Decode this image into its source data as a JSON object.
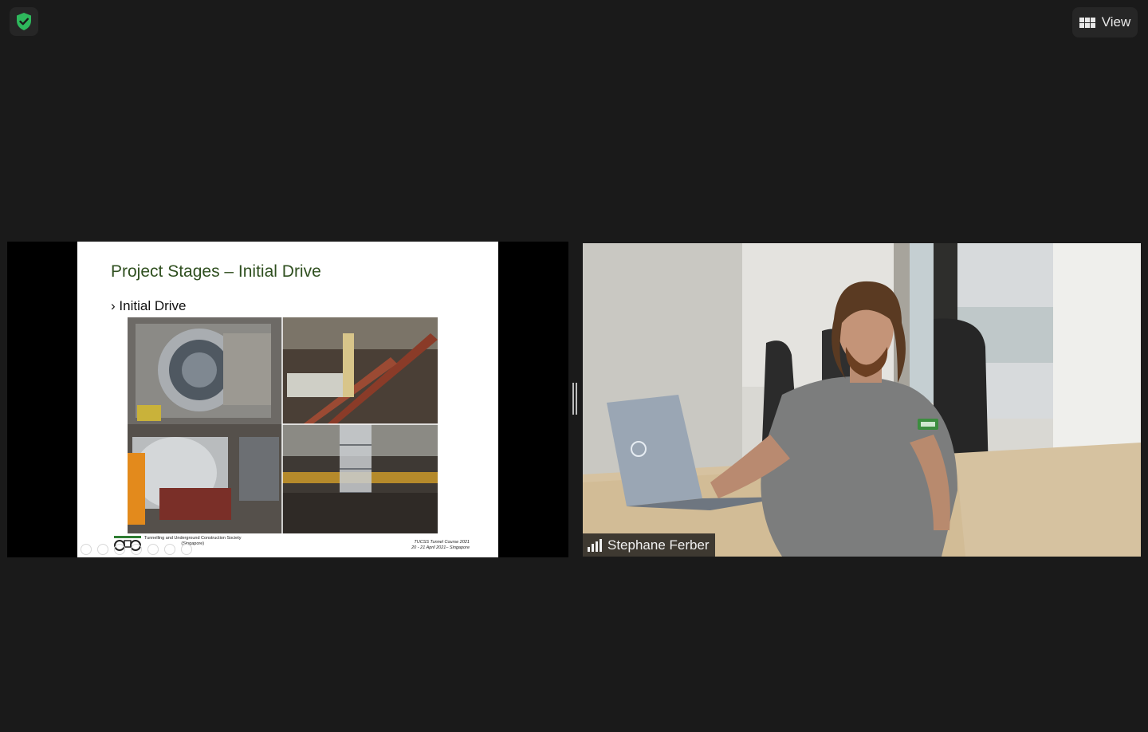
{
  "toolbar": {
    "security_icon": "shield-check-icon",
    "security_color": "#2eb85c",
    "view_icon": "grid-icon",
    "view_label": "View"
  },
  "shared_screen": {
    "slide_title": "Project Stages – Initial Drive",
    "bullet_marker": "›",
    "bullet_text": "Initial Drive",
    "footer_org_line1": "Tunnelling and Underground Construction Society",
    "footer_org_line2": "(Singapore)",
    "footer_event_line1": "TUCSS Tunnel Course 2021",
    "footer_event_line2": "20 - 21 April 2021– Singapore",
    "title_color": "#2f4f1f"
  },
  "participant": {
    "name": "Stephane Ferber",
    "signal_icon": "signal-bars-icon"
  }
}
